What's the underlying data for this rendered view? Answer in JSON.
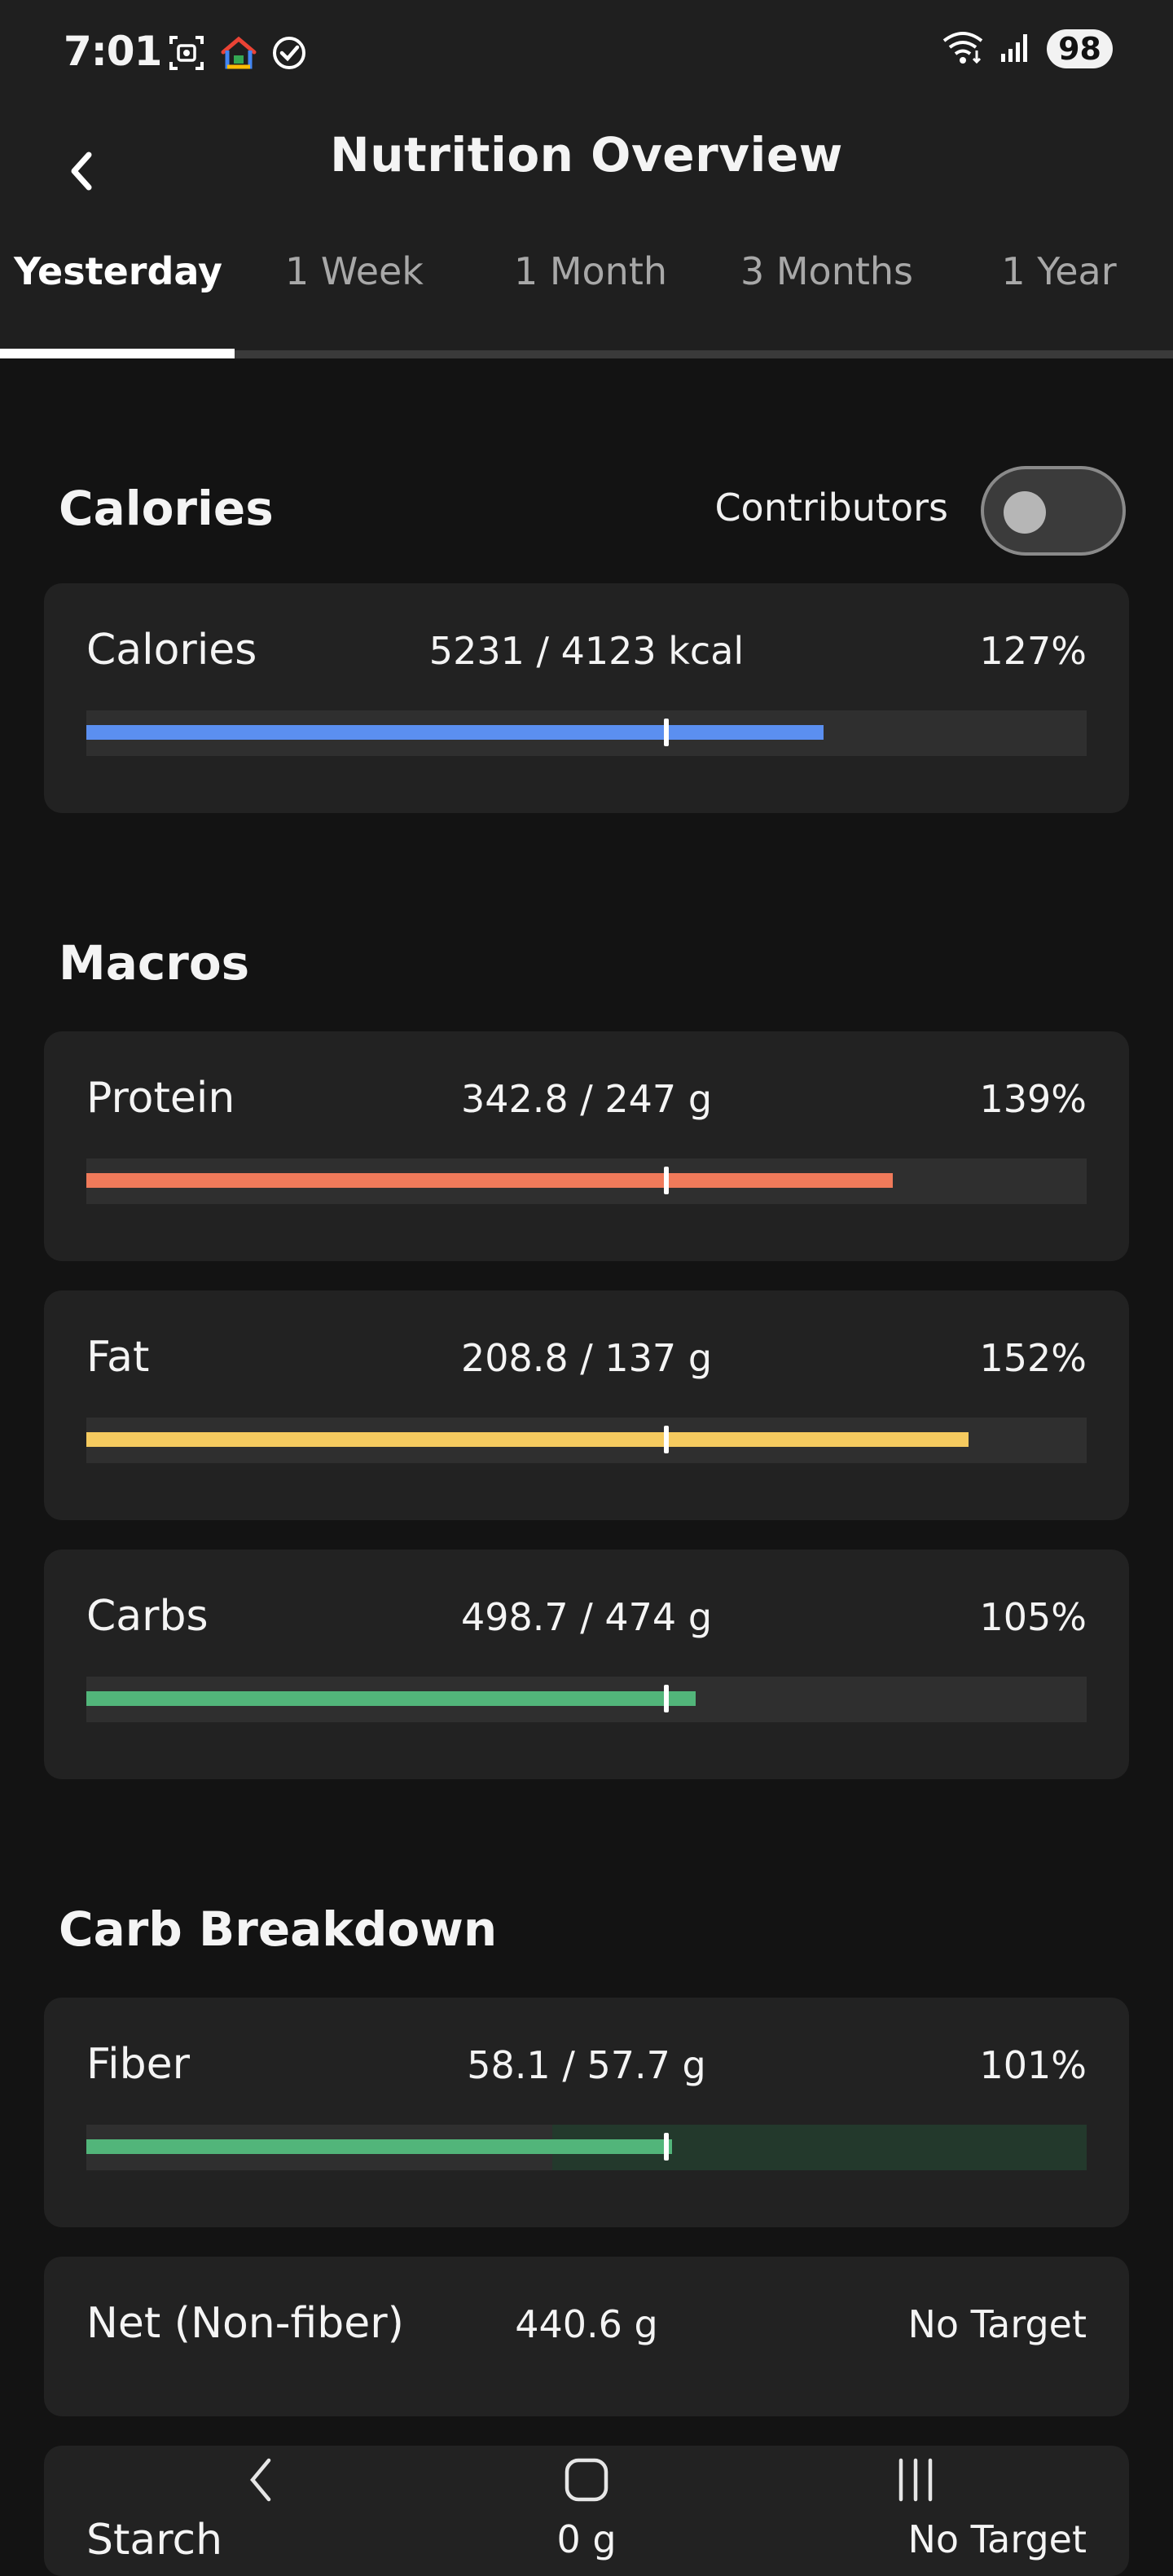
{
  "status_bar": {
    "time": "7:01",
    "battery": "98",
    "icons_left": [
      "screenshot-icon",
      "home-app-icon",
      "check-circle-icon"
    ],
    "icons_right": [
      "wifi-icon",
      "signal-icon",
      "battery-icon"
    ]
  },
  "header": {
    "title": "Nutrition Overview"
  },
  "tabs": [
    {
      "label": "Yesterday",
      "active": true
    },
    {
      "label": "1 Week",
      "active": false
    },
    {
      "label": "1 Month",
      "active": false
    },
    {
      "label": "3 Months",
      "active": false
    },
    {
      "label": "1 Year",
      "active": false
    }
  ],
  "calories_section": {
    "title": "Calories",
    "contributors_label": "Contributors",
    "contributors_on": false,
    "card": {
      "name": "Calories",
      "amount": "5231 / 4123 kcal",
      "percent": "127%",
      "progress": 1.27,
      "color": "#5b8ff0"
    }
  },
  "macros_section": {
    "title": "Macros",
    "cards": [
      {
        "name": "Protein",
        "amount": "342.8 / 247 g",
        "percent": "139%",
        "progress": 1.39,
        "color": "#f07a5a"
      },
      {
        "name": "Fat",
        "amount": "208.8 / 137 g",
        "percent": "152%",
        "progress": 1.52,
        "color": "#f5ca5f"
      },
      {
        "name": "Carbs",
        "amount": "498.7 / 474 g",
        "percent": "105%",
        "progress": 1.05,
        "color": "#52b57a"
      }
    ]
  },
  "carb_breakdown_section": {
    "title": "Carb Breakdown",
    "fiber": {
      "name": "Fiber",
      "amount": "58.1 / 57.7 g",
      "percent": "101%",
      "progress": 1.01,
      "color": "#52b57a"
    },
    "net": {
      "name": "Net (Non-fiber)",
      "amount": "440.6 g",
      "percent": "No Target"
    },
    "starch": {
      "name": "Starch",
      "amount": "0 g",
      "percent": "No Target"
    }
  },
  "nav_bar": {
    "icons": [
      "back-nav-icon",
      "home-nav-icon",
      "recents-nav-icon"
    ]
  }
}
